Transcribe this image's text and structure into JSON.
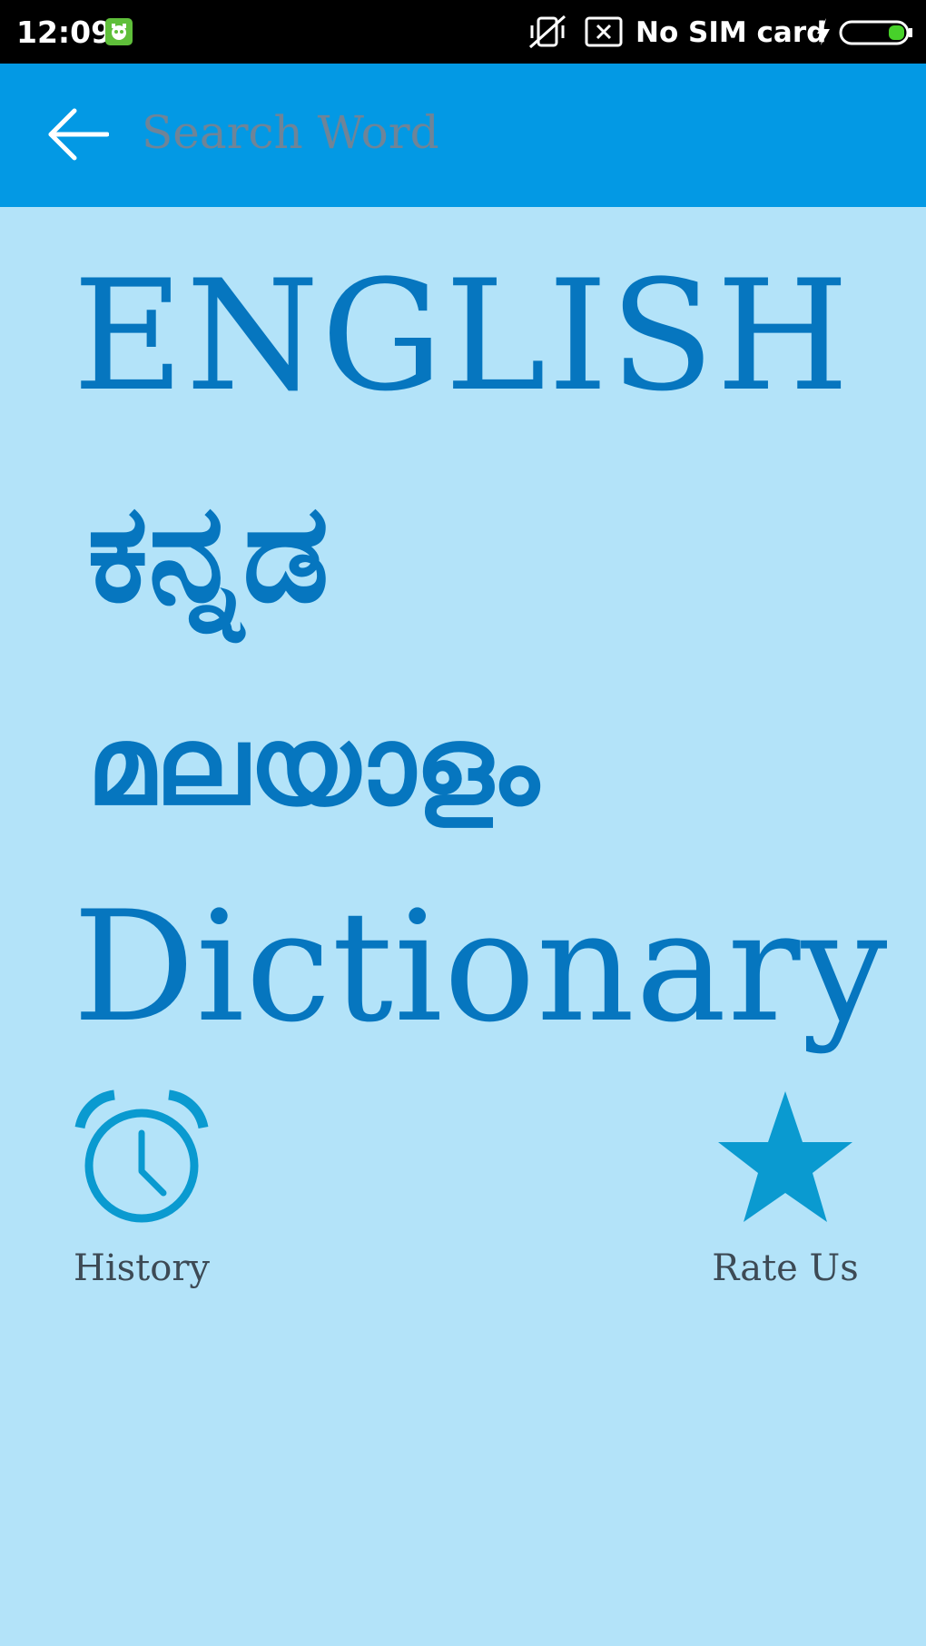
{
  "status_bar": {
    "time": "12:09",
    "carrier": "No SIM card",
    "icons": [
      "app-notification-icon",
      "vibrate-icon",
      "no-sim-icon",
      "charging-icon",
      "battery-icon"
    ],
    "battery_level": 0.25
  },
  "toolbar": {
    "back_icon": "arrow-left-icon",
    "search_placeholder": "Search Word",
    "search_value": ""
  },
  "title": {
    "english": "ENGLISH",
    "kannada": "ಕನ್ನಡ",
    "malayalam": "മലയാളം",
    "dictionary": "Dictionary"
  },
  "actions": {
    "history": {
      "label": "History",
      "icon": "alarm-clock-icon"
    },
    "rate": {
      "label": "Rate Us",
      "icon": "star-icon"
    }
  },
  "colors": {
    "status_bar": "#000000",
    "toolbar": "#0399e4",
    "background": "#b3e3f9",
    "title_text": "#0676bf",
    "action_icon": "#0a9ad0",
    "label_text": "#3d4a55"
  }
}
